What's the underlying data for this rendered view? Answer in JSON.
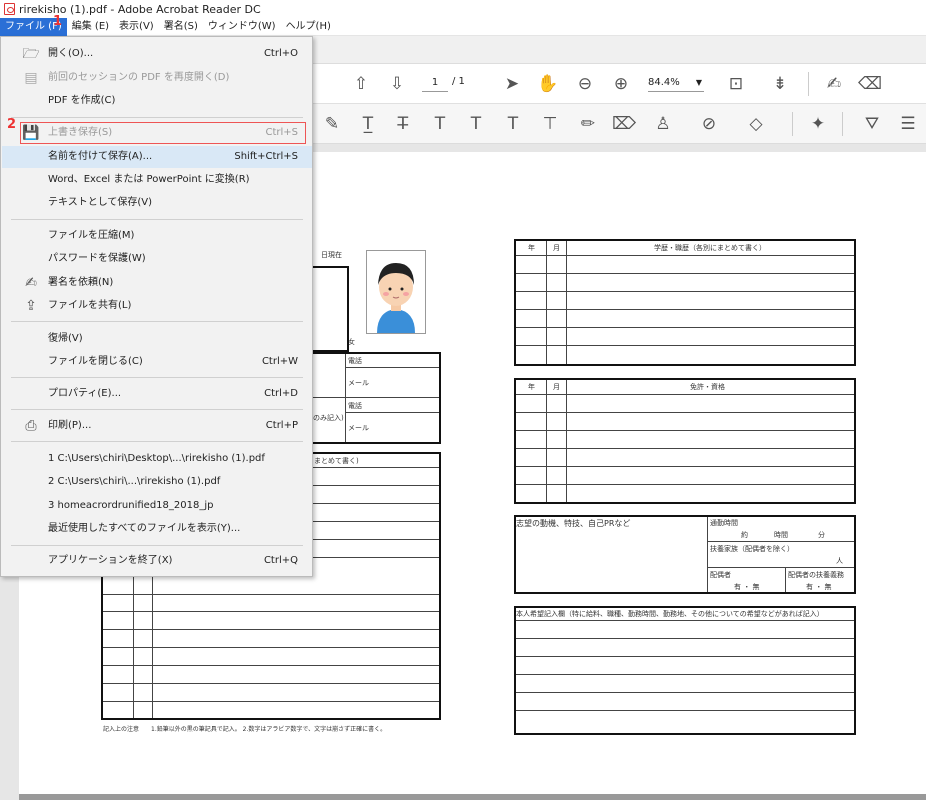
{
  "window": {
    "title": "rirekisho (1).pdf - Adobe Acrobat Reader DC"
  },
  "menubar": [
    {
      "label": "ファイル (F)",
      "active": true
    },
    {
      "label": "編集 (E)"
    },
    {
      "label": "表示(V)"
    },
    {
      "label": "署名(S)"
    },
    {
      "label": "ウィンドウ(W)"
    },
    {
      "label": "ヘルプ(H)"
    }
  ],
  "markers": {
    "one": "1",
    "two": "2"
  },
  "toolbar": {
    "page_current": "1",
    "page_total": "/ 1",
    "zoom": "84.4%"
  },
  "file_menu": {
    "items": [
      {
        "label": "開く(O)...",
        "shortcut": "Ctrl+O",
        "icon": "folder-open-icon"
      },
      {
        "label": "前回のセッションの PDF を再度開く(D)",
        "shortcut": "",
        "icon": "restore-session-icon",
        "disabled": true
      },
      {
        "label": "PDF を作成(C)",
        "shortcut": ""
      },
      {
        "label": "上書き保存(S)",
        "shortcut": "Ctrl+S",
        "icon": "save-icon",
        "disabled": true
      },
      {
        "label": "名前を付けて保存(A)...",
        "shortcut": "Shift+Ctrl+S"
      },
      {
        "label": "Word、Excel または PowerPoint に変換(R)",
        "shortcut": ""
      },
      {
        "label": "テキストとして保存(V)",
        "shortcut": ""
      },
      {
        "label": "ファイルを圧縮(M)",
        "shortcut": ""
      },
      {
        "label": "パスワードを保護(W)",
        "shortcut": ""
      },
      {
        "label": "署名を依頼(N)",
        "shortcut": "",
        "icon": "request-signature-icon"
      },
      {
        "label": "ファイルを共有(L)",
        "shortcut": "",
        "icon": "share-icon"
      },
      {
        "label": "復帰(V)",
        "shortcut": ""
      },
      {
        "label": "ファイルを閉じる(C)",
        "shortcut": "Ctrl+W"
      },
      {
        "label": "プロパティ(E)...",
        "shortcut": "Ctrl+D"
      },
      {
        "label": "印刷(P)...",
        "shortcut": "Ctrl+P",
        "icon": "print-icon"
      },
      {
        "label": "1 C:\\Users\\chiri\\Desktop\\...\\rirekisho (1).pdf",
        "shortcut": ""
      },
      {
        "label": "2 C:\\Users\\chiri\\...\\rirekisho (1).pdf",
        "shortcut": ""
      },
      {
        "label": "3 homeacrordrunified18_2018_jp",
        "shortcut": ""
      },
      {
        "label": "最近使用したすべてのファイルを表示(Y)...",
        "shortcut": ""
      },
      {
        "label": "アプリケーションを終了(X)",
        "shortcut": "Ctrl+Q"
      }
    ]
  },
  "resume": {
    "date_label": "日現在",
    "female_label": "女",
    "phone1": "電話",
    "mail1": "メール",
    "phone2": "電話",
    "mail2": "メール",
    "contact_note": "のみ記入)",
    "history_note": "まとめて書く)",
    "edu_year": "年",
    "edu_month": "月",
    "edu_title": "学歴・職歴（各別にまとめて書く）",
    "lic_year": "年",
    "lic_month": "月",
    "lic_title": "免許・資格",
    "motive": "志望の動機、特技、自己PRなど",
    "commute": "通勤時間",
    "commute_approx": "約",
    "commute_hours": "時間",
    "commute_min": "分",
    "dependents": "扶養家族（配偶者を除く）",
    "dependents_unit": "人",
    "spouse": "配偶者",
    "spouse_support": "配偶者の扶養義務",
    "yes_no_1": "有 ・ 無",
    "yes_no_2": "有 ・ 無",
    "wish": "本人希望記入欄（特に給料、職種、勤務時間、勤務地、その他についての希望などがあれば記入）",
    "footnote": "記入上の注意　　1.鉛筆以外の黒の筆記具で記入。 2.数字はアラビア数字で、文字は崩さず正確に書く。"
  }
}
